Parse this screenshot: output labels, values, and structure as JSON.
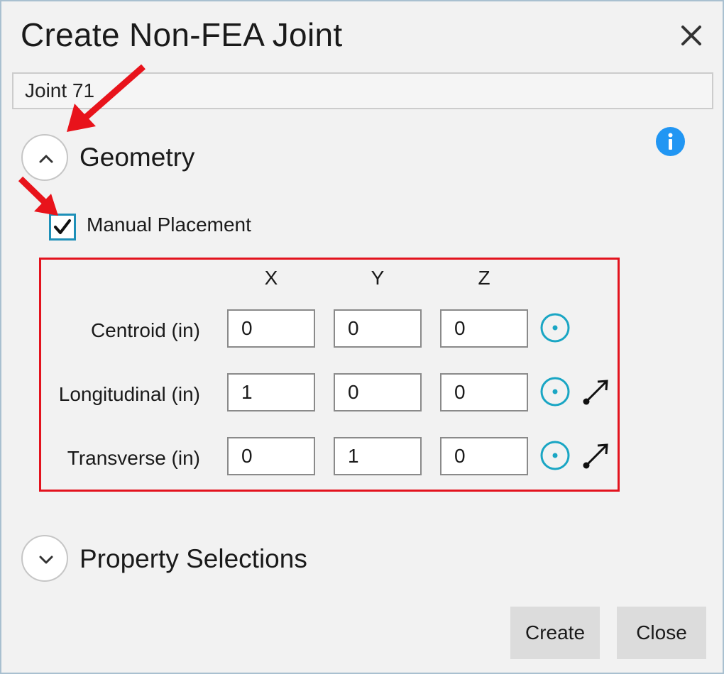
{
  "dialog": {
    "title": "Create Non-FEA Joint",
    "close_icon": "close-icon",
    "name_value": "Joint 71"
  },
  "geometry": {
    "label": "Geometry",
    "expand_icon": "chevron-up-icon",
    "info_icon": "info-icon",
    "manual_placement_label": "Manual Placement",
    "manual_placement_checked": true,
    "columns": [
      "X",
      "Y",
      "Z"
    ],
    "rows": [
      {
        "label": "Centroid (in)",
        "values": [
          "0",
          "0",
          "0"
        ],
        "has_vector_icon": false
      },
      {
        "label": "Longitudinal (in)",
        "values": [
          "1",
          "0",
          "0"
        ],
        "has_vector_icon": true
      },
      {
        "label": "Transverse (in)",
        "values": [
          "0",
          "1",
          "0"
        ],
        "has_vector_icon": true
      }
    ]
  },
  "property_selections": {
    "label": "Property Selections",
    "expand_icon": "chevron-down-icon"
  },
  "buttons": {
    "create": "Create",
    "close": "Close"
  },
  "colors": {
    "accent_teal": "#1aa6c4",
    "info_blue": "#2196f3",
    "highlight_red": "#e3131e",
    "annotation_arrow": "#e8131b"
  }
}
